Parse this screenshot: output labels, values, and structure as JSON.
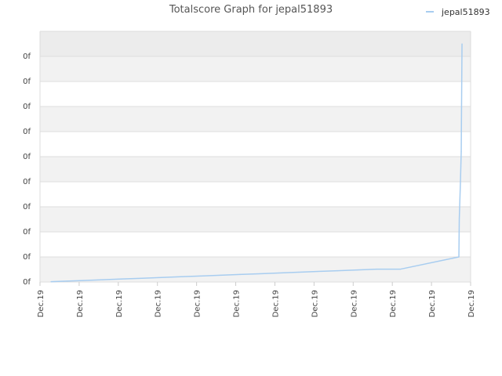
{
  "chart_data": {
    "type": "line",
    "title": "Totalscore Graph for jepal51893",
    "legend": {
      "position": "top-right",
      "entries": [
        "jepal51893"
      ]
    },
    "series_color": "#a8cdf0",
    "band_color": "#f2f2f2",
    "grid_color": "#dddddd",
    "grid": true,
    "yticks": [
      "0f",
      "0f",
      "0f",
      "0f",
      "0f",
      "0f",
      "0f",
      "0f",
      "0f",
      "0f"
    ],
    "xticks": [
      "Dec.19",
      "Dec.19",
      "Dec.19",
      "Dec.19",
      "Dec.19",
      "Dec.19",
      "Dec.19",
      "Dec.19",
      "Dec.19",
      "Dec.19",
      "Dec.19",
      "Dec.19"
    ],
    "xlim": [
      0,
      11
    ],
    "ylim": [
      0,
      10
    ],
    "series": [
      {
        "name": "jepal51893",
        "points": [
          [
            0.28,
            0.01
          ],
          [
            0.6,
            0.03
          ],
          [
            1.1,
            0.06
          ],
          [
            1.6,
            0.09
          ],
          [
            2.1,
            0.12
          ],
          [
            2.6,
            0.15
          ],
          [
            3.1,
            0.18
          ],
          [
            3.6,
            0.21
          ],
          [
            4.1,
            0.24
          ],
          [
            4.6,
            0.27
          ],
          [
            5.1,
            0.3
          ],
          [
            5.6,
            0.33
          ],
          [
            6.1,
            0.36
          ],
          [
            6.6,
            0.39
          ],
          [
            7.1,
            0.42
          ],
          [
            7.6,
            0.45
          ],
          [
            8.1,
            0.48
          ],
          [
            8.6,
            0.51
          ],
          [
            9.2,
            0.51
          ],
          [
            10.7,
            1.0
          ],
          [
            10.71,
            2.5
          ],
          [
            10.74,
            4.0
          ],
          [
            10.76,
            5.2
          ],
          [
            10.78,
            9.5
          ]
        ]
      }
    ]
  }
}
